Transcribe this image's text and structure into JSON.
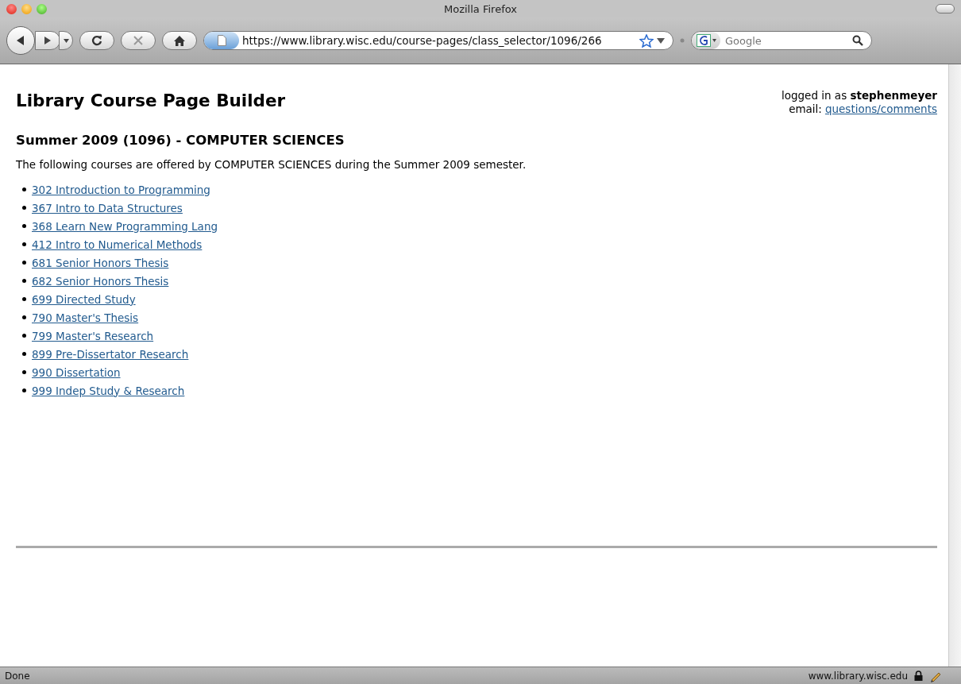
{
  "window": {
    "title": "Mozilla Firefox"
  },
  "toolbar": {
    "url": "https://www.library.wisc.edu/course-pages/class_selector/1096/266",
    "search_placeholder": "Google"
  },
  "page": {
    "title": "Library Course Page Builder",
    "user": {
      "logged_in": "logged in as **stephenmeyer**",
      "email_label": "email:",
      "email_link": "questions/comments"
    },
    "heading": "Summer 2009 (1096) - COMPUTER SCIENCES",
    "intro": "The following courses are offered by COMPUTER SCIENCES during the Summer 2009 semester.",
    "courses": [
      "302 Introduction to Programming",
      "367 Intro to Data Structures",
      "368 Learn New Programming Lang",
      "412 Intro to Numerical Methods",
      "681 Senior Honors Thesis",
      "682 Senior Honors Thesis",
      "699 Directed Study",
      "790 Master's Thesis",
      "799 Master's Research",
      "899 Pre-Dissertator Research",
      "990 Dissertation",
      "999 Indep Study & Research"
    ]
  },
  "status_bar": {
    "status": "Done",
    "host": "www.library.wisc.edu"
  }
}
